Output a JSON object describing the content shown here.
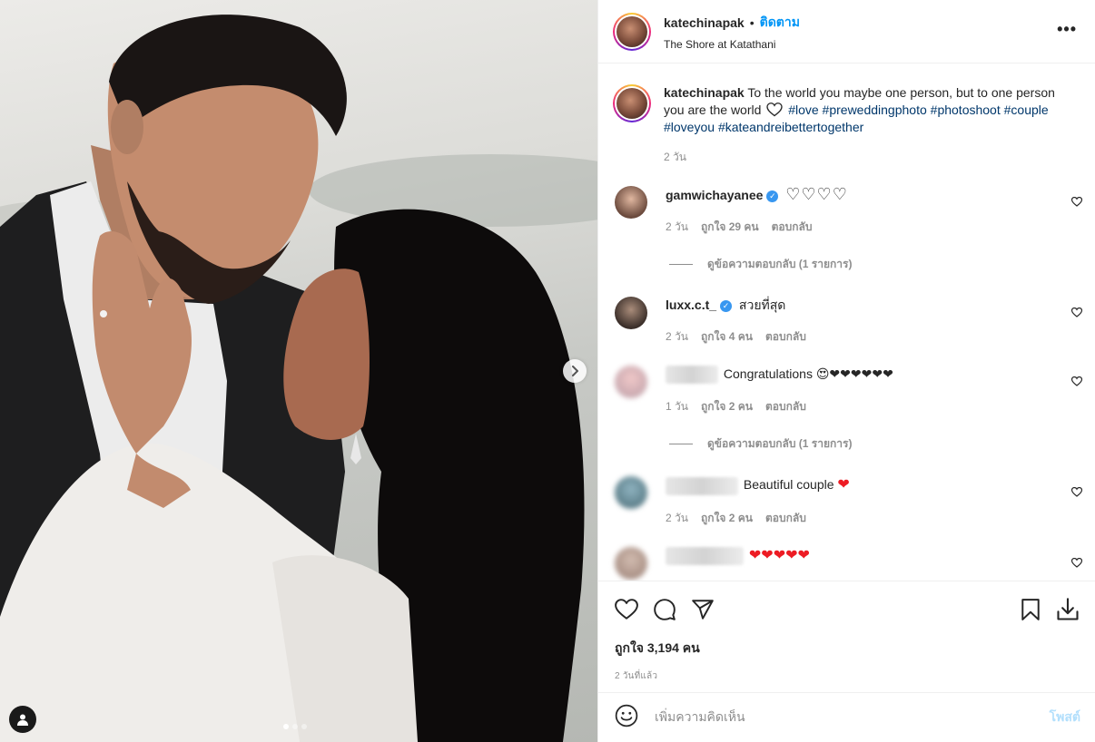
{
  "post": {
    "username": "katechinapak",
    "follow_label": "ติดตาม",
    "separator": "•",
    "location": "The Shore at Katathani",
    "more_label": "•••"
  },
  "caption": {
    "username": "katechinapak",
    "text": "To the world you maybe one person, but to one person you are the world",
    "hashtags": [
      "#love",
      "#preweddingphoto",
      "#photoshoot",
      "#couple",
      "#loveyou",
      "#kateandreibettertogether"
    ],
    "time": "2 วัน"
  },
  "comments": [
    {
      "username": "gamwichayanee",
      "verified": true,
      "text": "♡♡♡♡",
      "time": "2 วัน",
      "likes": "ถูกใจ 29 คน",
      "reply_label": "ตอบกลับ",
      "view_replies": "ดูข้อความตอบกลับ (1 รายการ)"
    },
    {
      "username": "luxx.c.t_",
      "verified": true,
      "text": "สวยที่สุด",
      "time": "2 วัน",
      "likes": "ถูกใจ 4 คน",
      "reply_label": "ตอบกลับ"
    },
    {
      "username": "",
      "text": "Congratulations 😍❤❤❤❤❤❤",
      "time": "1 วัน",
      "likes": "ถูกใจ 2 คน",
      "reply_label": "ตอบกลับ",
      "view_replies": "ดูข้อความตอบกลับ (1 รายการ)"
    },
    {
      "username": "",
      "text": "Beautiful couple",
      "heart": "❤",
      "time": "2 วัน",
      "likes": "ถูกใจ 2 คน",
      "reply_label": "ตอบกลับ"
    },
    {
      "username": "",
      "text": "❤❤❤❤❤"
    }
  ],
  "stats": {
    "likes": "ถูกใจ 3,194 คน",
    "posted": "2 วันที่แล้ว"
  },
  "composer": {
    "placeholder": "เพิ่มความคิดเห็น",
    "post_label": "โพสต์"
  },
  "icons": {
    "like": "heart-icon",
    "comment": "comment-icon",
    "share": "share-icon",
    "save": "bookmark-icon",
    "download": "download-icon",
    "emoji": "emoji-icon",
    "next": "chevron-right-icon",
    "tag": "user-tag-icon"
  },
  "carousel": {
    "count": 3,
    "active_index": 0
  }
}
